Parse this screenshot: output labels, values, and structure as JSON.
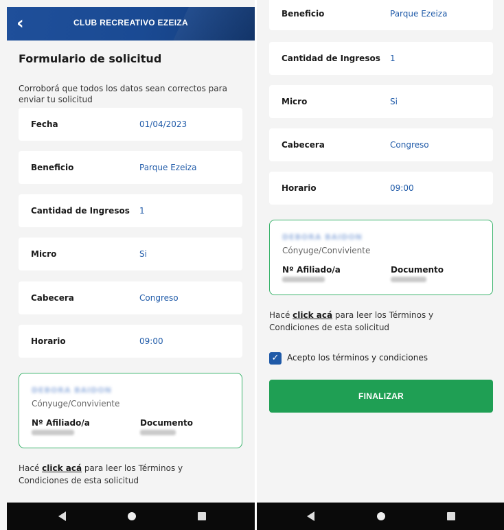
{
  "header": {
    "title": "CLUB RECREATIVO EZEIZA",
    "back_glyph": "‹"
  },
  "form": {
    "title": "Formulario de solicitud",
    "intro": "Corroborá que todos los datos sean correctos para enviar tu solicitud",
    "rows": [
      {
        "label": "Fecha",
        "value": "01/04/2023"
      },
      {
        "label": "Beneficio",
        "value": "Parque Ezeiza"
      },
      {
        "label": "Cantidad de Ingresos",
        "value": "1"
      },
      {
        "label": "Micro",
        "value": "Si"
      },
      {
        "label": "Cabecera",
        "value": "Congreso"
      },
      {
        "label": "Horario",
        "value": "09:00"
      }
    ]
  },
  "member": {
    "name": "DEBORA      BAIDON",
    "relation": "Cónyuge/Conviviente",
    "affiliate_label": "Nº Afiliado/a",
    "document_label": "Documento"
  },
  "terms": {
    "prefix": "Hacé ",
    "link": "click acá",
    "suffix": " para leer los Términos y Condiciones de esta solicitud"
  },
  "accept": {
    "label": "Acepto los términos y condiciones",
    "checked": true
  },
  "finalize_label": "FINALIZAR",
  "colors": {
    "header": "#1a4a93",
    "accent": "#1f5aa8",
    "success": "#1f9f54",
    "card_border": "#39b36b"
  }
}
